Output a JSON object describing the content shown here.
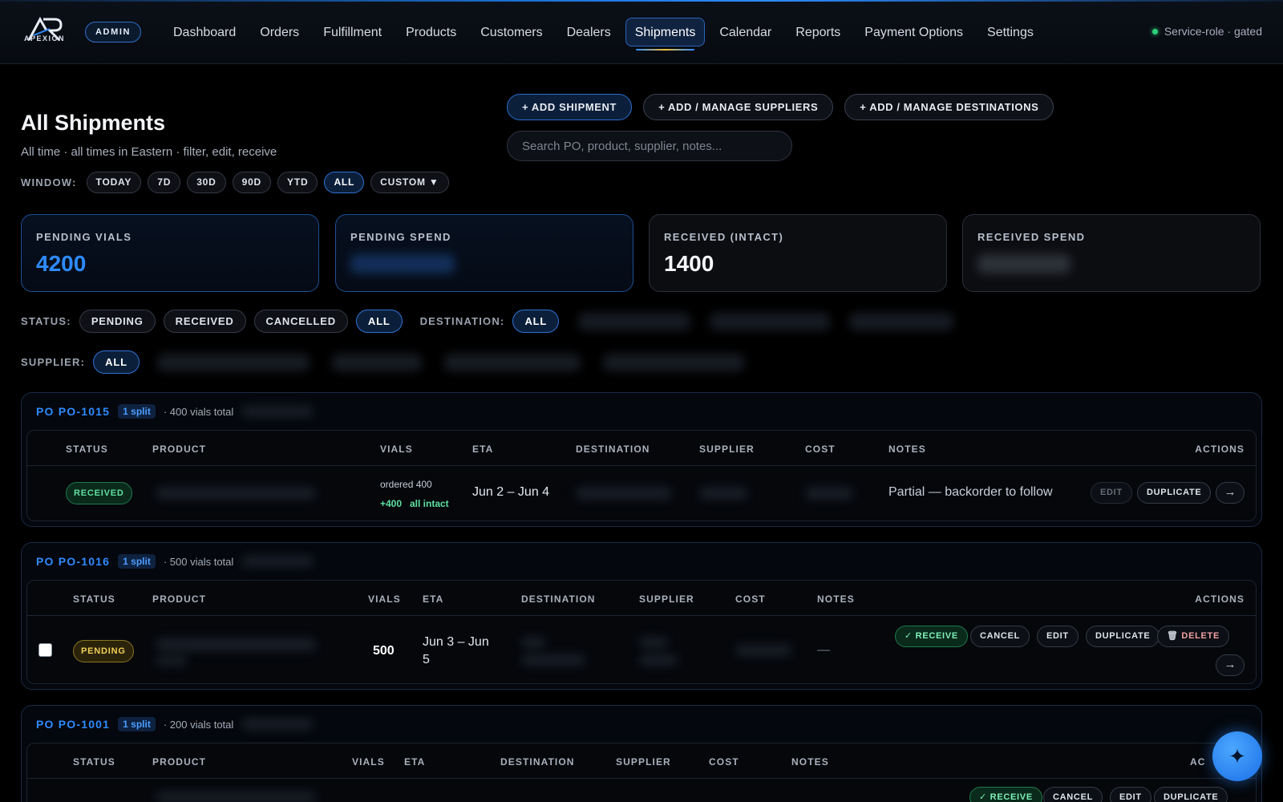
{
  "brand": {
    "name": "APEXION",
    "role_badge": "ADMIN"
  },
  "nav": {
    "items": [
      "Dashboard",
      "Orders",
      "Fulfillment",
      "Products",
      "Customers",
      "Dealers",
      "Shipments",
      "Calendar",
      "Reports",
      "Payment Options",
      "Settings"
    ],
    "active": "Shipments",
    "service_status": "Service-role · gated"
  },
  "header": {
    "title": "All Shipments",
    "subtitle": "All time · all times in Eastern · filter, edit, receive"
  },
  "actions": {
    "add_shipment": "+ ADD SHIPMENT",
    "manage_suppliers": "+ ADD / MANAGE SUPPLIERS",
    "manage_destinations": "+ ADD / MANAGE DESTINATIONS"
  },
  "search": {
    "placeholder": "Search PO, product, supplier, notes...",
    "value": ""
  },
  "window_filter": {
    "label": "WINDOW:",
    "options": [
      "TODAY",
      "7D",
      "30D",
      "90D",
      "YTD",
      "ALL",
      "CUSTOM ▼"
    ],
    "selected": "ALL"
  },
  "stats": [
    {
      "label": "PENDING VIALS",
      "value": "4200"
    },
    {
      "label": "PENDING SPEND",
      "value": ""
    },
    {
      "label": "RECEIVED (INTACT)",
      "value": "1400"
    },
    {
      "label": "RECEIVED SPEND",
      "value": ""
    }
  ],
  "status_filter": {
    "label": "STATUS:",
    "options": [
      "PENDING",
      "RECEIVED",
      "CANCELLED",
      "ALL"
    ],
    "selected": "ALL"
  },
  "destination_filter": {
    "label": "DESTINATION:",
    "selected": "ALL"
  },
  "supplier_filter": {
    "label": "SUPPLIER:",
    "selected": "ALL"
  },
  "columns": {
    "status": "STATUS",
    "product": "PRODUCT",
    "vials": "VIALS",
    "eta": "ETA",
    "destination": "DESTINATION",
    "supplier": "SUPPLIER",
    "cost": "COST",
    "notes": "NOTES",
    "actions": "ACTIONS",
    "actions_partial": "AC"
  },
  "action_labels": {
    "receive": "✓ RECEIVE",
    "cancel": "CANCEL",
    "edit": "EDIT",
    "duplicate": "DUPLICATE",
    "delete": "DELETE",
    "open": "→"
  },
  "shipments": [
    {
      "po": "PO PO-1015",
      "splits": "1 split",
      "total": "· 400 vials total",
      "status": "RECEIVED",
      "vials_ordered": "ordered 400",
      "vials_received": "+400",
      "vials_condition": "all intact",
      "eta": "Jun 2 – Jun 4",
      "notes": "Partial — backorder to follow"
    },
    {
      "po": "PO PO-1016",
      "splits": "1 split",
      "total": "· 500 vials total",
      "status": "PENDING",
      "vials": "500",
      "eta_line1": "Jun 3 – Jun",
      "eta_line2": "5",
      "notes": "—"
    },
    {
      "po": "PO PO-1001",
      "splits": "1 split",
      "total": "· 200 vials total"
    }
  ],
  "colors": {
    "accent": "#2e8bff",
    "success": "#5fe0a0",
    "warning": "#f0cf58",
    "background": "#000000"
  },
  "icons": {
    "fab": "sparkle-icon",
    "delete": "trash-icon",
    "status_dot": "status-dot-icon"
  }
}
